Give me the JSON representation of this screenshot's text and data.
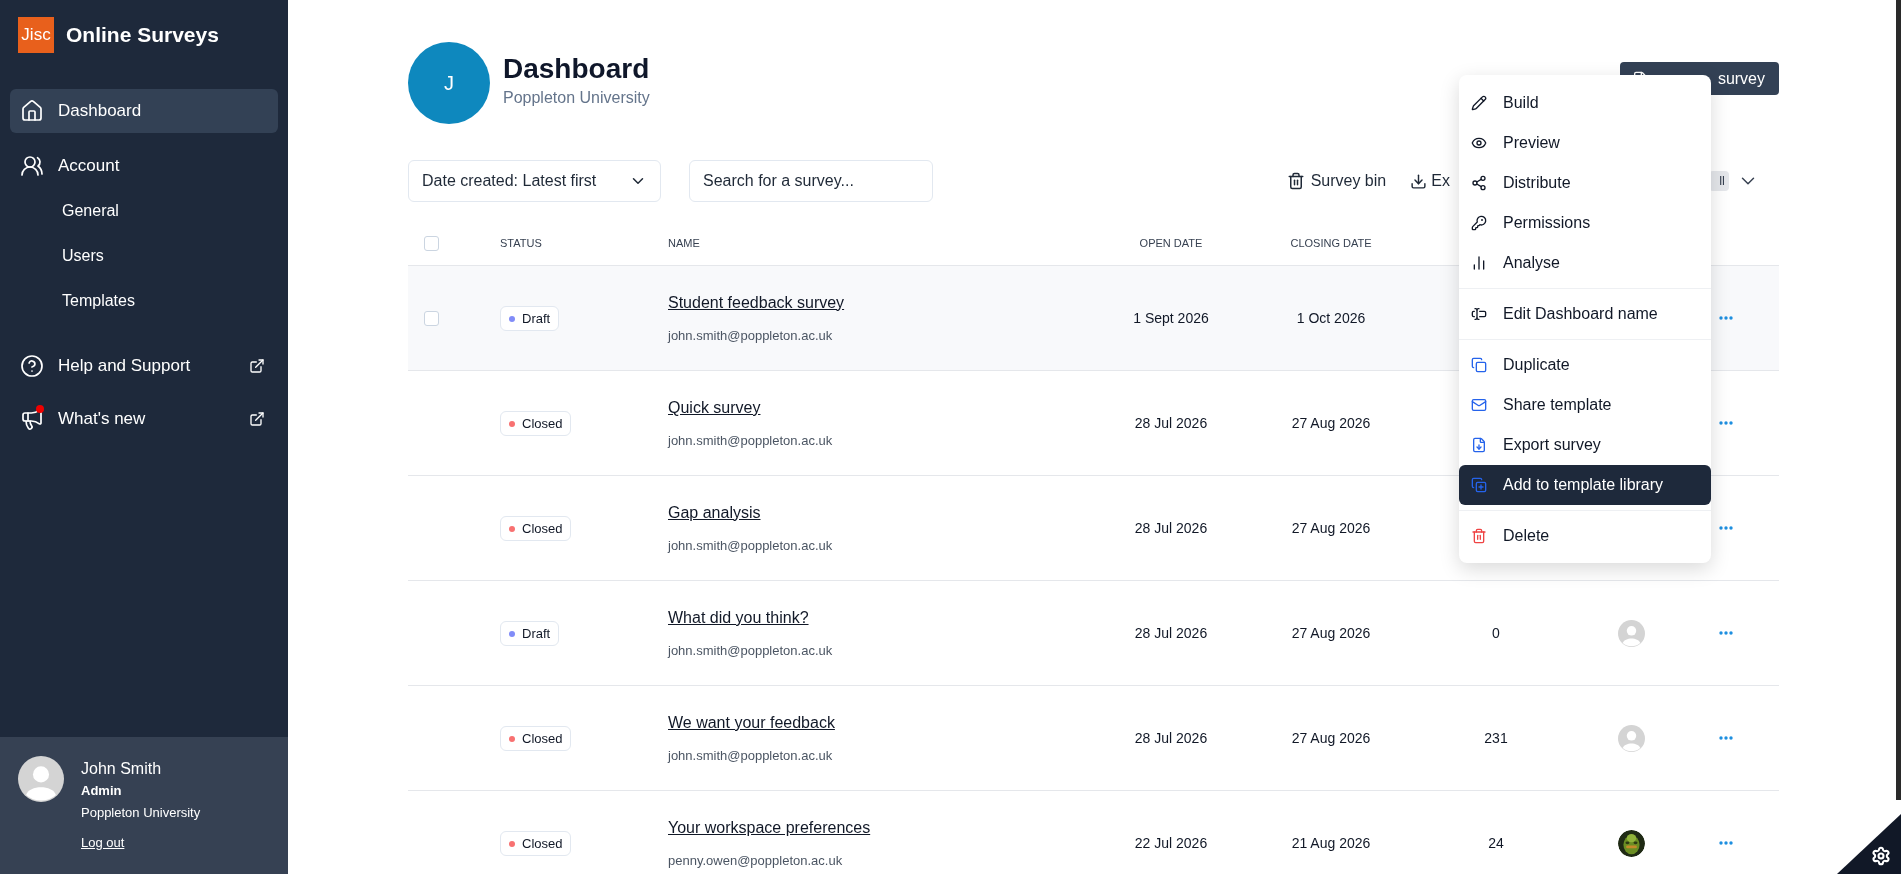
{
  "sidebar": {
    "logo": "Jisc",
    "app_name": "Online Surveys",
    "nav": [
      {
        "label": "Dashboard",
        "selected": true,
        "external": false,
        "notification": false
      },
      {
        "label": "Account",
        "selected": false,
        "external": false,
        "notification": false,
        "children": [
          {
            "label": "General",
            "selected": false
          },
          {
            "label": "Users",
            "selected": false
          },
          {
            "label": "Templates",
            "selected": false
          }
        ]
      },
      {
        "label": "Help and Support",
        "selected": false,
        "external": true,
        "notification": false
      },
      {
        "label": "What's new",
        "selected": false,
        "external": true,
        "notification": true
      }
    ],
    "user": {
      "name": "John Smith",
      "role": "Admin",
      "organisation": "Poppleton University",
      "logout": "Log out"
    }
  },
  "header": {
    "avatar_letter": "J",
    "title": "Dashboard",
    "subtitle": "Poppleton University",
    "create_button": "survey"
  },
  "toolbar": {
    "sort": "Date created: Latest first",
    "search_placeholder": "Search for a survey...",
    "bin": "Survey bin",
    "export": "Ex",
    "filter_chip": "ll"
  },
  "table": {
    "header_checked": false,
    "columns": [
      "STATUS",
      "NAME",
      "OPEN DATE",
      "CLOSING DATE"
    ],
    "rows": [
      {
        "status": "Draft",
        "color": "#818cf8",
        "name": "Student feedback survey",
        "owner_email": "john.smith@poppleton.ac.uk",
        "open_date": "1 Sept 2026",
        "closing_date": "1 Oct 2026",
        "highlighted": true
      },
      {
        "status": "Closed",
        "color": "#f87171",
        "name": "Quick survey",
        "owner_email": "john.smith@poppleton.ac.uk",
        "open_date": "28 Jul 2026",
        "closing_date": "27 Aug 2026",
        "highlighted": false
      },
      {
        "status": "Closed",
        "color": "#f87171",
        "name": "Gap analysis",
        "owner_email": "john.smith@poppleton.ac.uk",
        "open_date": "28 Jul 2026",
        "closing_date": "27 Aug 2026",
        "highlighted": false
      },
      {
        "status": "Draft",
        "color": "#818cf8",
        "name": "What did you think?",
        "owner_email": "john.smith@poppleton.ac.uk",
        "open_date": "28 Jul 2026",
        "closing_date": "27 Aug 2026",
        "highlighted": false,
        "responses": "0",
        "owner_avatar": {
          "kind": "placeholder"
        }
      },
      {
        "status": "Closed",
        "color": "#f87171",
        "name": "We want your feedback",
        "owner_email": "john.smith@poppleton.ac.uk",
        "open_date": "28 Jul 2026",
        "closing_date": "27 Aug 2026",
        "highlighted": false,
        "responses": "231",
        "owner_avatar": {
          "kind": "placeholder"
        }
      },
      {
        "status": "Closed",
        "color": "#f87171",
        "name": "Your workspace preferences",
        "owner_email": "penny.owen@poppleton.ac.uk",
        "open_date": "22 Jul 2026",
        "closing_date": "21 Aug 2026",
        "highlighted": false,
        "responses": "24"
      }
    ]
  },
  "menu": {
    "groups": [
      {
        "items": [
          {
            "label": "Build",
            "selected": false
          },
          {
            "label": "Preview",
            "selected": false
          },
          {
            "label": "Distribute",
            "selected": false
          },
          {
            "label": "Permissions",
            "selected": false
          },
          {
            "label": "Analyse",
            "selected": false
          }
        ]
      },
      {
        "items": [
          {
            "label": "Edit Dashboard name",
            "selected": false
          }
        ]
      },
      {
        "items": [
          {
            "label": "Duplicate",
            "selected": false
          },
          {
            "label": "Share template",
            "selected": false
          },
          {
            "label": "Export survey",
            "selected": false
          },
          {
            "label": "Add to template library",
            "selected": true
          }
        ]
      },
      {
        "items": [
          {
            "label": "Delete",
            "selected": false
          }
        ]
      }
    ]
  }
}
